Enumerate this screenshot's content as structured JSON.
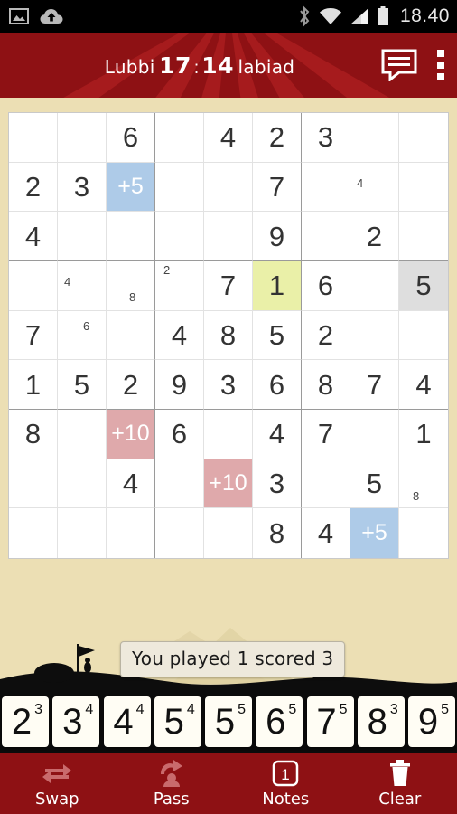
{
  "statusbar": {
    "clock": "18.40",
    "icons": [
      "image-icon",
      "cloud-upload-icon",
      "bluetooth-icon",
      "wifi-icon",
      "signal-icon",
      "battery-icon"
    ]
  },
  "actionbar": {
    "player_left": "Lubbi",
    "score_left": "17",
    "separator": ":",
    "score_right": "14",
    "player_right": "labiad",
    "chat_icon": "chat-bubble-icon",
    "overflow_icon": "more-vertical-icon",
    "brand_color": "#8e1114"
  },
  "board": {
    "rows": 9,
    "cols": 9,
    "colors": {
      "bonus5": "#aecbe8",
      "bonus10": "#dfa9ab",
      "selected": "#eaf0a8",
      "grey": "#dedede",
      "background": "#ecdfb4"
    },
    "cells": [
      [
        {
          "v": ""
        },
        {
          "v": ""
        },
        {
          "v": "6"
        },
        {
          "v": ""
        },
        {
          "v": "4"
        },
        {
          "v": "2"
        },
        {
          "v": "3"
        },
        {
          "v": ""
        },
        {
          "v": ""
        }
      ],
      [
        {
          "v": "2"
        },
        {
          "v": "3"
        },
        {
          "v": "+5",
          "t": "bonus5"
        },
        {
          "v": ""
        },
        {
          "v": ""
        },
        {
          "v": "7"
        },
        {
          "v": ""
        },
        {
          "v": "",
          "n": "4",
          "np": "tl"
        },
        {
          "v": ""
        }
      ],
      [
        {
          "v": "4"
        },
        {
          "v": ""
        },
        {
          "v": ""
        },
        {
          "v": ""
        },
        {
          "v": ""
        },
        {
          "v": "9"
        },
        {
          "v": ""
        },
        {
          "v": "2"
        },
        {
          "v": ""
        }
      ],
      [
        {
          "v": ""
        },
        {
          "v": "",
          "n": "4",
          "np": "tl"
        },
        {
          "v": "",
          "n": "8",
          "np": "bc"
        },
        {
          "v": "",
          "n": "2",
          "np": "tl2"
        },
        {
          "v": "7"
        },
        {
          "v": "1",
          "t": "sel"
        },
        {
          "v": "6"
        },
        {
          "v": ""
        },
        {
          "v": "5",
          "t": "grey"
        }
      ],
      [
        {
          "v": "7"
        },
        {
          "v": "",
          "n": "6",
          "np": "cr"
        },
        {
          "v": ""
        },
        {
          "v": "4"
        },
        {
          "v": "8"
        },
        {
          "v": "5"
        },
        {
          "v": "2"
        },
        {
          "v": ""
        },
        {
          "v": ""
        }
      ],
      [
        {
          "v": "1"
        },
        {
          "v": "5"
        },
        {
          "v": "2"
        },
        {
          "v": "9"
        },
        {
          "v": "3"
        },
        {
          "v": "6"
        },
        {
          "v": "8"
        },
        {
          "v": "7"
        },
        {
          "v": "4"
        }
      ],
      [
        {
          "v": "8"
        },
        {
          "v": ""
        },
        {
          "v": "+10",
          "t": "bonus10"
        },
        {
          "v": "6"
        },
        {
          "v": ""
        },
        {
          "v": "4"
        },
        {
          "v": "7"
        },
        {
          "v": ""
        },
        {
          "v": "1"
        }
      ],
      [
        {
          "v": ""
        },
        {
          "v": ""
        },
        {
          "v": "4"
        },
        {
          "v": ""
        },
        {
          "v": "+10",
          "t": "bonus10"
        },
        {
          "v": "3"
        },
        {
          "v": ""
        },
        {
          "v": "5"
        },
        {
          "v": "",
          "n": "8",
          "np": "bl"
        }
      ],
      [
        {
          "v": ""
        },
        {
          "v": ""
        },
        {
          "v": ""
        },
        {
          "v": ""
        },
        {
          "v": ""
        },
        {
          "v": "8"
        },
        {
          "v": "4"
        },
        {
          "v": "+5",
          "t": "bonus5"
        },
        {
          "v": ""
        }
      ]
    ]
  },
  "message": {
    "text": "You played 1 scored 3"
  },
  "rack": {
    "tiles": [
      {
        "num": "2",
        "points": "3"
      },
      {
        "num": "3",
        "points": "4"
      },
      {
        "num": "4",
        "points": "4"
      },
      {
        "num": "5",
        "points": "4"
      },
      {
        "num": "5",
        "points": "5"
      },
      {
        "num": "6",
        "points": "5"
      },
      {
        "num": "7",
        "points": "5"
      },
      {
        "num": "8",
        "points": "3"
      },
      {
        "num": "9",
        "points": "5"
      }
    ]
  },
  "navbar": {
    "items": [
      {
        "label": "Swap",
        "icon": "swap-arrows-icon"
      },
      {
        "label": "Pass",
        "icon": "pass-rotate-icon"
      },
      {
        "label": "Notes",
        "icon": "notes-box-icon",
        "badge": "1"
      },
      {
        "label": "Clear",
        "icon": "trash-icon"
      }
    ]
  }
}
